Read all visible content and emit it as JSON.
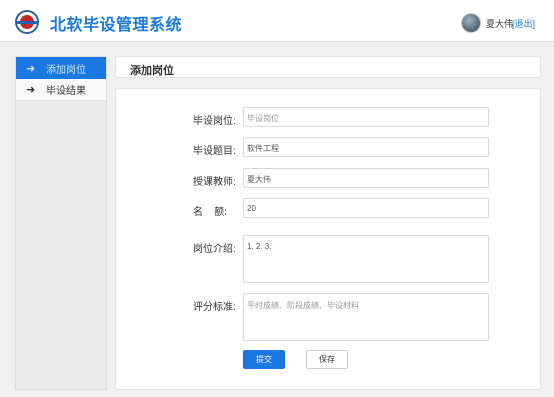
{
  "header": {
    "app_title": "北软毕设管理系统",
    "username": "夏大伟",
    "logout_label": "[退出]"
  },
  "sidebar": {
    "items": [
      {
        "label": "添加岗位",
        "icon": "arrow-right-icon",
        "active": true
      },
      {
        "label": "毕设结果",
        "icon": "arrow-right-icon",
        "active": false
      }
    ],
    "arrow_glyph": "➜"
  },
  "main": {
    "section_title": "添加岗位",
    "form": {
      "position_label": "毕设岗位:",
      "position_placeholder": "毕设岗位",
      "topic_label": "毕设题目:",
      "topic_value": "软件工程",
      "teacher_label": "授课教师:",
      "teacher_value": "夏大伟",
      "quota_label": "名    额:",
      "quota_value": "20",
      "intro_label": "岗位介绍:",
      "intro_value": "1.     2.     3.",
      "grading_label": "评分标准:",
      "grading_placeholder": "平时成绩、阶段成绩、毕设材料"
    },
    "submit_label": "提交",
    "save_label": "保存"
  },
  "colors": {
    "accent": "#1a78e0",
    "background": "#f0f0f0"
  }
}
